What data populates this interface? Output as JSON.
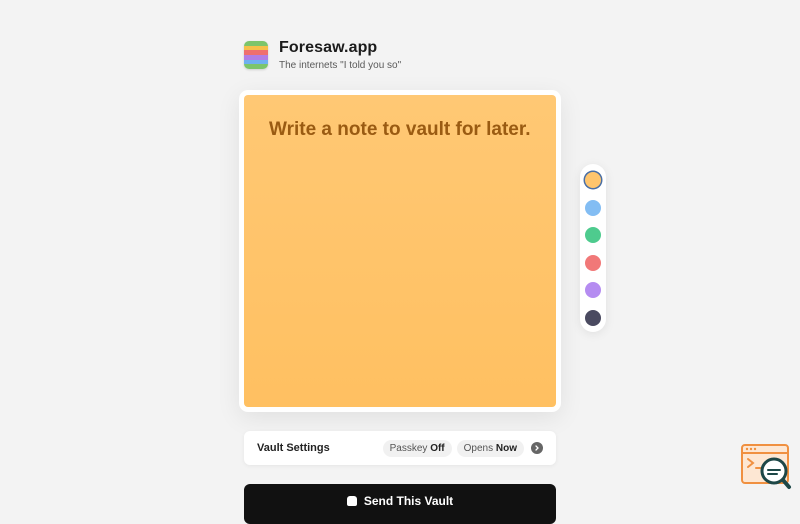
{
  "brand": {
    "title": "Foresaw.app",
    "tagline": "The internets \"I told you so\"",
    "logo_colors": [
      "#7cc56b",
      "#f5c04a",
      "#ef6f6f",
      "#b07ee6",
      "#6fb0f0",
      "#7cc56b"
    ]
  },
  "note": {
    "placeholder": "Write a note to vault for later.",
    "color": "#ffc56d"
  },
  "palette": {
    "swatches": [
      {
        "name": "orange",
        "color": "#ffc56d",
        "selected": true
      },
      {
        "name": "blue",
        "color": "#83bdf3",
        "selected": false
      },
      {
        "name": "green",
        "color": "#4ecb8e",
        "selected": false
      },
      {
        "name": "red",
        "color": "#f17878",
        "selected": false
      },
      {
        "name": "purple",
        "color": "#b58cf1",
        "selected": false
      },
      {
        "name": "dark",
        "color": "#4a4a60",
        "selected": false
      }
    ]
  },
  "settings": {
    "label": "Vault Settings",
    "passkey_label": "Passkey",
    "passkey_value": "Off",
    "opens_label": "Opens",
    "opens_value": "Now",
    "icon": "chevron-right-icon"
  },
  "send": {
    "label": "Send This Vault",
    "icon": "lock-icon"
  },
  "corner_widget": {
    "icon": "search-terminal-icon",
    "accent": "#f09040",
    "dark": "#1d4747"
  }
}
